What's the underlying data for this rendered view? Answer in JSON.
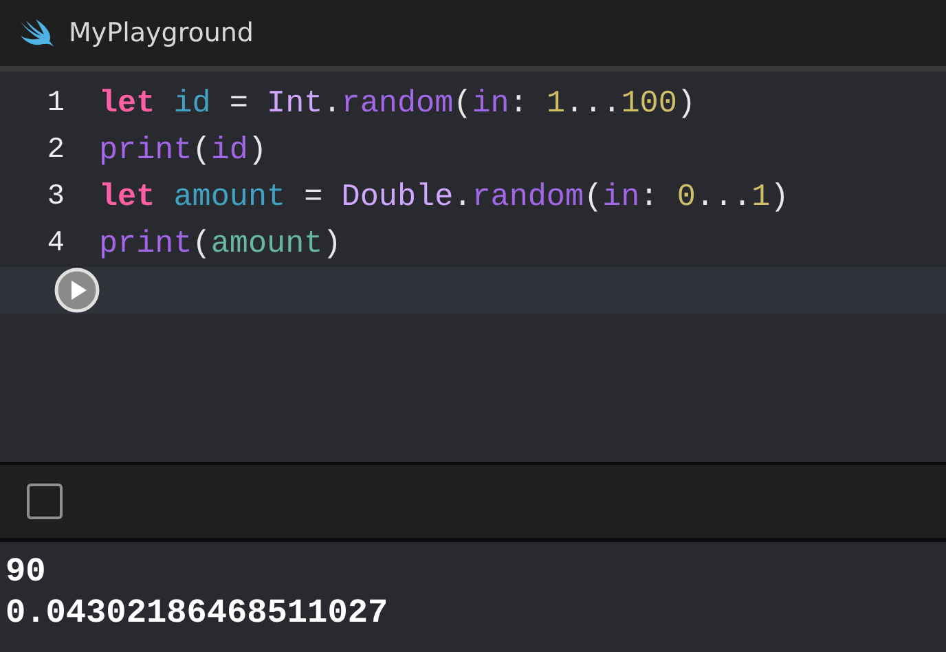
{
  "window": {
    "title": "MyPlayground"
  },
  "editor": {
    "lines": [
      {
        "number": "1",
        "tokens": [
          {
            "text": "let ",
            "kind": "keyword"
          },
          {
            "text": "id",
            "kind": "declaration"
          },
          {
            "text": " = ",
            "kind": "plain"
          },
          {
            "text": "Int",
            "kind": "type"
          },
          {
            "text": ".",
            "kind": "plain"
          },
          {
            "text": "random",
            "kind": "function"
          },
          {
            "text": "(",
            "kind": "plain"
          },
          {
            "text": "in",
            "kind": "function"
          },
          {
            "text": ": ",
            "kind": "plain"
          },
          {
            "text": "1",
            "kind": "number"
          },
          {
            "text": "...",
            "kind": "plain"
          },
          {
            "text": "100",
            "kind": "number"
          },
          {
            "text": ")",
            "kind": "plain"
          }
        ]
      },
      {
        "number": "2",
        "tokens": [
          {
            "text": "print",
            "kind": "function"
          },
          {
            "text": "(",
            "kind": "plain"
          },
          {
            "text": "id",
            "kind": "function"
          },
          {
            "text": ")",
            "kind": "plain"
          }
        ]
      },
      {
        "number": "3",
        "tokens": [
          {
            "text": "let ",
            "kind": "keyword"
          },
          {
            "text": "amount",
            "kind": "declaration"
          },
          {
            "text": " = ",
            "kind": "plain"
          },
          {
            "text": "Double",
            "kind": "type"
          },
          {
            "text": ".",
            "kind": "plain"
          },
          {
            "text": "random",
            "kind": "function"
          },
          {
            "text": "(",
            "kind": "plain"
          },
          {
            "text": "in",
            "kind": "function"
          },
          {
            "text": ": ",
            "kind": "plain"
          },
          {
            "text": "0",
            "kind": "number"
          },
          {
            "text": "...",
            "kind": "plain"
          },
          {
            "text": "1",
            "kind": "number"
          },
          {
            "text": ")",
            "kind": "plain"
          }
        ]
      },
      {
        "number": "4",
        "tokens": [
          {
            "text": "print",
            "kind": "function"
          },
          {
            "text": "(",
            "kind": "plain"
          },
          {
            "text": "amount",
            "kind": "variable"
          },
          {
            "text": ")",
            "kind": "plain"
          }
        ]
      }
    ]
  },
  "console": {
    "output": [
      "90",
      "0.04302186468511027"
    ]
  }
}
